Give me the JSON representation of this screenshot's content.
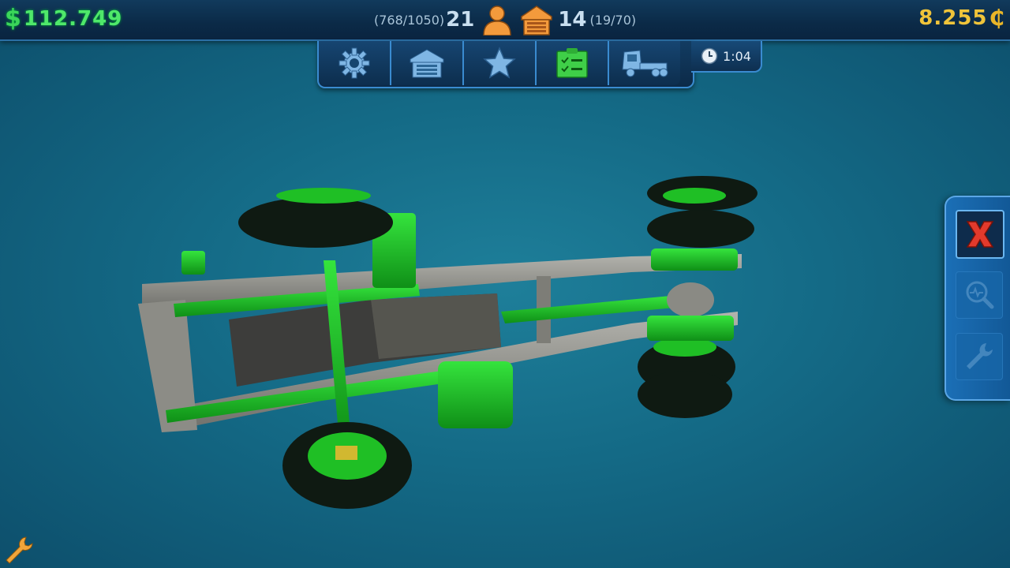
{
  "hud": {
    "cash": "112.749",
    "cash_symbol": "$",
    "coins": "8.255",
    "coins_symbol": "₵",
    "workers_capacity": "(768/1050)",
    "workers_count": "21",
    "garage_count": "14",
    "garage_capacity": "(19/70)",
    "timer": "1:04"
  },
  "tabs": [
    {
      "name": "settings",
      "icon": "gear-icon"
    },
    {
      "name": "garage",
      "icon": "garage-icon"
    },
    {
      "name": "favorites",
      "icon": "star-icon"
    },
    {
      "name": "tasks",
      "icon": "clipboard-icon"
    },
    {
      "name": "truck",
      "icon": "truck-icon"
    }
  ],
  "side_panel": {
    "buttons": [
      {
        "name": "close",
        "icon": "close-x-icon",
        "active": true
      },
      {
        "name": "inspect",
        "icon": "magnifier-pulse-icon",
        "active": false
      },
      {
        "name": "repair",
        "icon": "wrench-icon",
        "active": false
      }
    ]
  },
  "colors": {
    "cash": "#4fe86a",
    "coins": "#f0c43a",
    "highlight_parts": "#1fcf2a",
    "frame": "#8a8a84",
    "accent_border": "#3a8bd0"
  }
}
